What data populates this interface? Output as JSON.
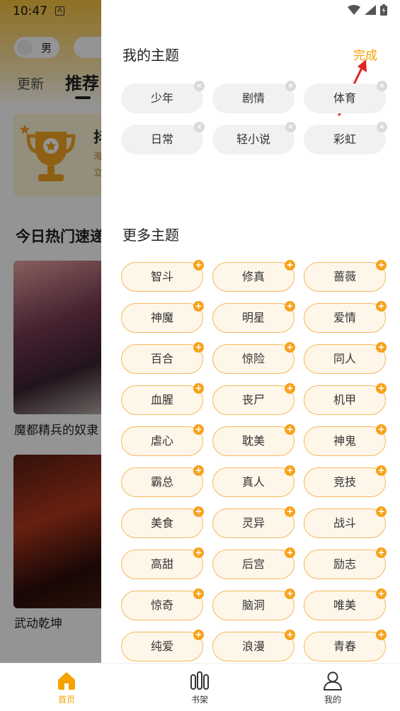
{
  "status_bar": {
    "time": "10:47",
    "a_icon": "A"
  },
  "background": {
    "gender_label": "男",
    "tabs": [
      "更新",
      "推荐"
    ],
    "promo": {
      "title": "抖",
      "line1": "海",
      "line2": "立"
    },
    "hot_section_title": "今日热门速递",
    "books": [
      "魔都精兵的奴隶",
      "武动乾坤"
    ]
  },
  "drawer": {
    "my_topics_title": "我的主题",
    "done_label": "完成",
    "my_topics": [
      "少年",
      "剧情",
      "体育",
      "日常",
      "轻小说",
      "彩虹"
    ],
    "remove_glyph": "×",
    "more_topics_title": "更多主题",
    "add_glyph": "+",
    "more_topics": [
      "智斗",
      "修真",
      "蔷薇",
      "神魔",
      "明星",
      "爱情",
      "百合",
      "惊险",
      "同人",
      "血腥",
      "丧尸",
      "机甲",
      "虐心",
      "耽美",
      "神鬼",
      "霸总",
      "真人",
      "竞技",
      "美食",
      "灵异",
      "战斗",
      "高甜",
      "后宫",
      "励志",
      "惊奇",
      "脑洞",
      "唯美",
      "纯爱",
      "浪漫",
      "青春"
    ]
  },
  "bottom_nav": [
    {
      "label": "首页",
      "icon": "home-icon",
      "active": true
    },
    {
      "label": "书架",
      "icon": "bookshelf-icon",
      "active": false
    },
    {
      "label": "我的",
      "icon": "profile-icon",
      "active": false
    }
  ],
  "colors": {
    "accent": "#f5a200",
    "annotation_arrow": "#e02525"
  }
}
